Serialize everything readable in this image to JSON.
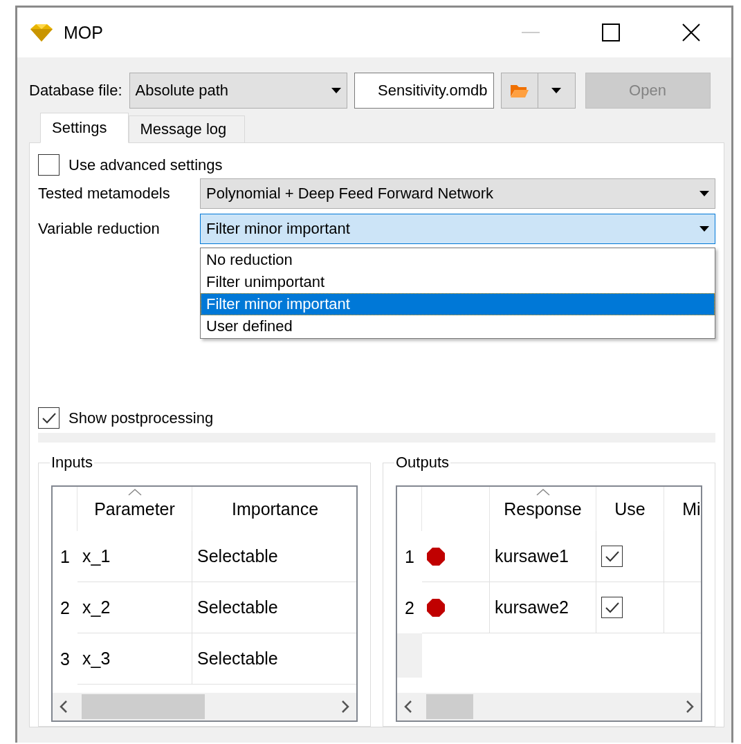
{
  "window": {
    "title": "MOP",
    "minimize_disabled": true
  },
  "database": {
    "label": "Database file:",
    "mode": "Absolute path",
    "path": "Sensitivity.omdb",
    "open_button": {
      "label": "Open",
      "disabled": true
    }
  },
  "tabs": [
    {
      "label": "Settings",
      "selected": true
    },
    {
      "label": "Message log",
      "selected": false
    }
  ],
  "advanced_settings": {
    "label": "Use advanced settings",
    "checked": false
  },
  "tested_metamodels": {
    "label": "Tested metamodels",
    "value": "Polynomial + Deep Feed Forward Network"
  },
  "variable_reduction": {
    "label": "Variable reduction",
    "value": "Filter minor important",
    "expanded": true,
    "options": [
      {
        "label": "No reduction",
        "selected": false
      },
      {
        "label": "Filter unimportant",
        "selected": false
      },
      {
        "label": "Filter minor important",
        "selected": true
      },
      {
        "label": "User defined",
        "selected": false
      }
    ]
  },
  "show_postprocessing": {
    "label": "Show postprocessing",
    "checked": true
  },
  "inputs": {
    "title": "Inputs",
    "columns": [
      {
        "label": "Parameter",
        "sorted": true
      },
      {
        "label": "Importance",
        "sorted": false
      }
    ],
    "rows": [
      {
        "number": "1",
        "parameter": "x_1",
        "importance": "Selectable"
      },
      {
        "number": "2",
        "parameter": "x_2",
        "importance": "Selectable"
      },
      {
        "number": "3",
        "parameter": "x_3",
        "importance": "Selectable"
      }
    ]
  },
  "outputs": {
    "title": "Outputs",
    "columns": [
      {
        "label": "Response",
        "sorted": true
      },
      {
        "label": "Use",
        "sorted": false
      },
      {
        "label": "Mi",
        "sorted": false
      }
    ],
    "rows": [
      {
        "number": "1",
        "color": "#c00000",
        "response": "kursawe1",
        "use": true
      },
      {
        "number": "2",
        "color": "#c00000",
        "response": "kursawe2",
        "use": true
      }
    ]
  }
}
